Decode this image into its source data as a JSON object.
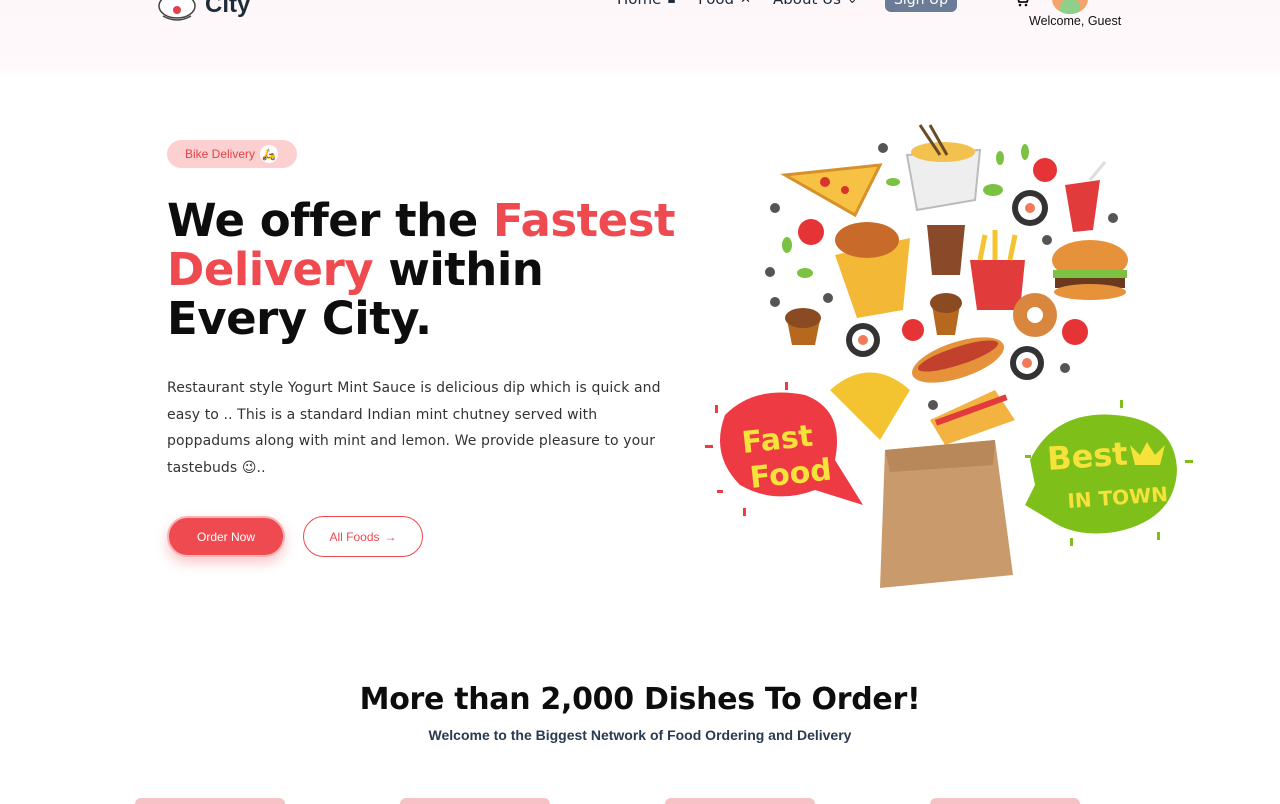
{
  "header": {
    "logo_text": "City",
    "nav": [
      {
        "label": "Home",
        "icon": "home-icon"
      },
      {
        "label": "Food",
        "icon": "utensils-icon"
      },
      {
        "label": "About Us",
        "icon": "chevron-down-icon"
      }
    ],
    "signup_label": "Sign Up",
    "welcome": "Welcome, Guest"
  },
  "hero": {
    "badge": "Bike Delivery",
    "title_part1": "We offer the ",
    "title_accent": "Fastest Delivery",
    "title_part2": " within Every City.",
    "description": "Restaurant style Yogurt Mint Sauce is delicious dip which is quick and easy to .. This is a standard Indian mint chutney served with poppadums along with mint and lemon. We provide pleasure to your tastebuds 😉..",
    "order_button": "Order Now",
    "all_foods_button": "All Foods",
    "art": {
      "left_bubble_line1": "Fast",
      "left_bubble_line2": "Food",
      "right_bubble_line1": "Best",
      "right_bubble_line2": "IN TOWN"
    }
  },
  "section": {
    "title": "More than 2,000 Dishes To Order!",
    "subtitle": "Welcome to the Biggest Network of Food Ordering and Delivery"
  },
  "colors": {
    "accent": "#ee4a4f",
    "badge_bg": "#fcd0d0",
    "signup_bg": "#6b7d96"
  }
}
